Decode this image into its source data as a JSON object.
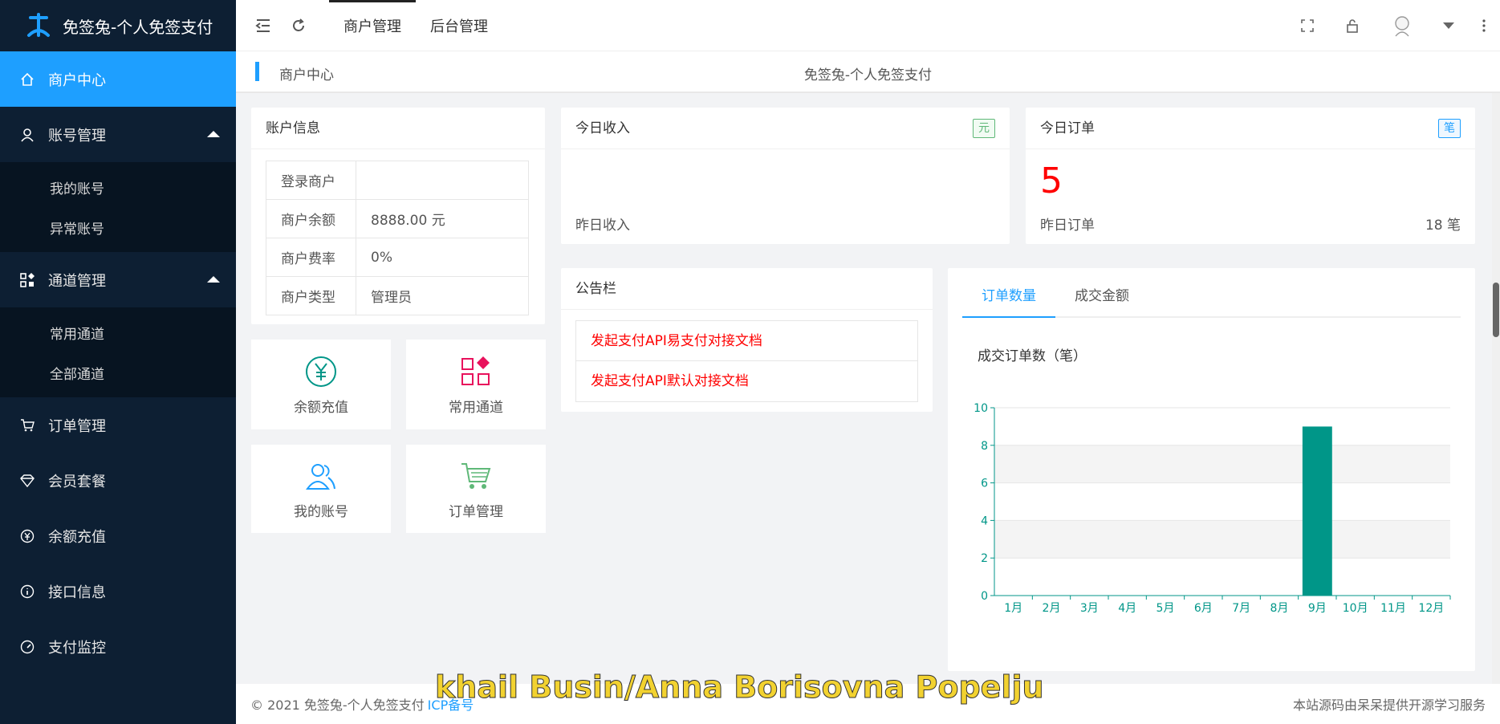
{
  "app": {
    "title": "免签兔-个人免签支付"
  },
  "sidebar": {
    "items": [
      {
        "label": "商户中心",
        "icon": "home-icon",
        "active": true
      },
      {
        "label": "账号管理",
        "icon": "user-icon",
        "expanded": true,
        "children": [
          "我的账号",
          "异常账号"
        ]
      },
      {
        "label": "通道管理",
        "icon": "grid-icon",
        "expanded": true,
        "children": [
          "常用通道",
          "全部通道"
        ]
      },
      {
        "label": "订单管理",
        "icon": "cart-icon"
      },
      {
        "label": "会员套餐",
        "icon": "diamond-icon"
      },
      {
        "label": "余额充值",
        "icon": "yen-icon"
      },
      {
        "label": "接口信息",
        "icon": "info-icon"
      },
      {
        "label": "支付监控",
        "icon": "gauge-icon"
      }
    ]
  },
  "header": {
    "tabs": [
      "商户管理",
      "后台管理"
    ]
  },
  "breadcrumb": {
    "current": "商户中心",
    "center_title": "免签兔-个人免签支付"
  },
  "account": {
    "title": "账户信息",
    "rows": [
      {
        "label": "登录商户",
        "value": ""
      },
      {
        "label": "商户余额",
        "value": "8888.00 元"
      },
      {
        "label": "商户费率",
        "value": "0%"
      },
      {
        "label": "商户类型",
        "value": "管理员"
      }
    ]
  },
  "quick": [
    {
      "label": "余额充值",
      "icon": "yen-circle-icon",
      "color": "#009688"
    },
    {
      "label": "常用通道",
      "icon": "apps-icon",
      "color": "#e8125c"
    },
    {
      "label": "我的账号",
      "icon": "users-icon",
      "color": "#1e9fff"
    },
    {
      "label": "订单管理",
      "icon": "cart-icon",
      "color": "#5fb878"
    }
  ],
  "income": {
    "title": "今日收入",
    "tag": "元",
    "yesterday_label": "昨日收入"
  },
  "orders": {
    "title": "今日订单",
    "tag": "笔",
    "today_value": "5",
    "yesterday_label": "昨日订单",
    "yesterday_value": "18 笔"
  },
  "notice": {
    "title": "公告栏",
    "items": [
      "发起支付API易支付对接文档",
      "发起支付API默认对接文档"
    ]
  },
  "chart_panel": {
    "tabs": [
      "订单数量",
      "成交金额"
    ],
    "active_tab": "订单数量"
  },
  "chart_data": {
    "type": "bar",
    "title": "成交订单数（笔）",
    "categories": [
      "1月",
      "2月",
      "3月",
      "4月",
      "5月",
      "6月",
      "7月",
      "8月",
      "9月",
      "10月",
      "11月",
      "12月"
    ],
    "values": [
      0,
      0,
      0,
      0,
      0,
      0,
      0,
      0,
      9,
      0,
      0,
      0
    ],
    "ylim": [
      0,
      10
    ],
    "yticks": [
      0,
      2,
      4,
      6,
      8,
      10
    ],
    "color": "#009688"
  },
  "footer": {
    "copyright": "© 2021 免签兔-个人免签支付",
    "beian": "ICP备号",
    "right_text": "本站源码由呆呆提供开源学习服务"
  },
  "overlay": {
    "watermark": "khail Busin/Anna Borisovna Popelju"
  }
}
